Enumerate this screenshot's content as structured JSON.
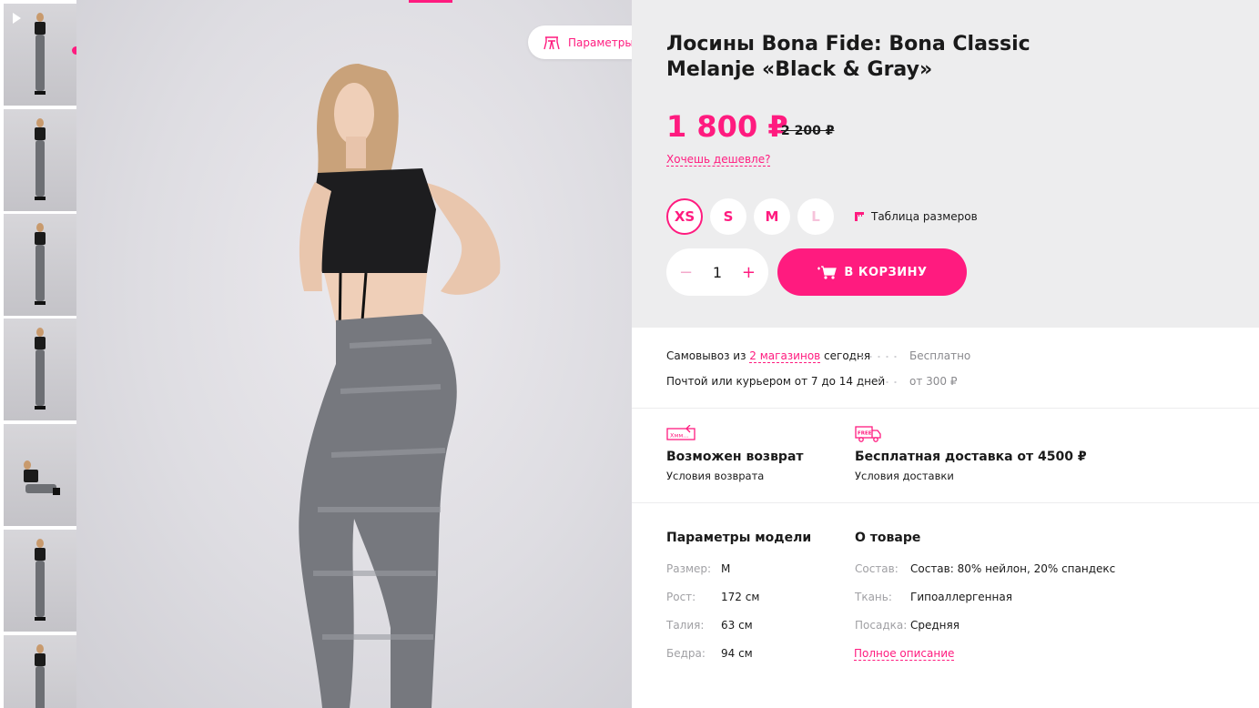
{
  "gallery": {
    "thumbnails": [
      {
        "pose": "stand"
      },
      {
        "pose": "stand"
      },
      {
        "pose": "stand"
      },
      {
        "pose": "stand"
      },
      {
        "pose": "sit"
      },
      {
        "pose": "stand"
      },
      {
        "pose": "stand"
      }
    ],
    "model_params_button": "Параметры модели"
  },
  "product": {
    "title_line1": "Лосины Bona Fide: Bona Classic",
    "title_line2": "Melanje «Black & Gray»",
    "price": "1 800 ₽",
    "old_price": "2 200 ₽",
    "cheaper_link": "Хочешь дешевле?",
    "sizes": [
      "XS",
      "S",
      "M",
      "L"
    ],
    "selected_size": "XS",
    "unavailable_sizes": [
      "L"
    ],
    "size_table": "Таблица размеров",
    "quantity": "1",
    "qty_minus": "−",
    "qty_plus": "+",
    "add_to_cart": "В КОРЗИНУ"
  },
  "delivery": {
    "pickup_prefix": "Самовывоз из ",
    "pickup_link": "2 магазинов",
    "pickup_suffix": " сегодня",
    "pickup_price": "Бесплатно",
    "post_text": "Почтой или курьером от 7 до 14 дней",
    "post_price": "от 300 ₽"
  },
  "features": {
    "return_icon_text": "Хмм...",
    "return_title": "Возможен возврат",
    "return_sub": "Условия возврата",
    "free_icon_text": "FREE",
    "free_title": "Бесплатная доставка от 4500 ₽",
    "free_sub": "Условия доставки"
  },
  "model_params": {
    "title": "Параметры модели",
    "rows": [
      {
        "label": "Размер:",
        "value": "M"
      },
      {
        "label": "Рост:",
        "value": "172 см"
      },
      {
        "label": "Талия:",
        "value": "63 см"
      },
      {
        "label": "Бедра:",
        "value": "94 см"
      }
    ]
  },
  "about": {
    "title": "О товаре",
    "rows": [
      {
        "label": "Состав:",
        "value": "Состав: 80% нейлон, 20% спандекс"
      },
      {
        "label": "Ткань:",
        "value": "Гипоаллергенная"
      },
      {
        "label": "Посадка:",
        "value": "Средняя"
      }
    ],
    "full_description": "Полное описание"
  },
  "colors": {
    "accent": "#ff1b7f",
    "panel": "#ededee"
  }
}
